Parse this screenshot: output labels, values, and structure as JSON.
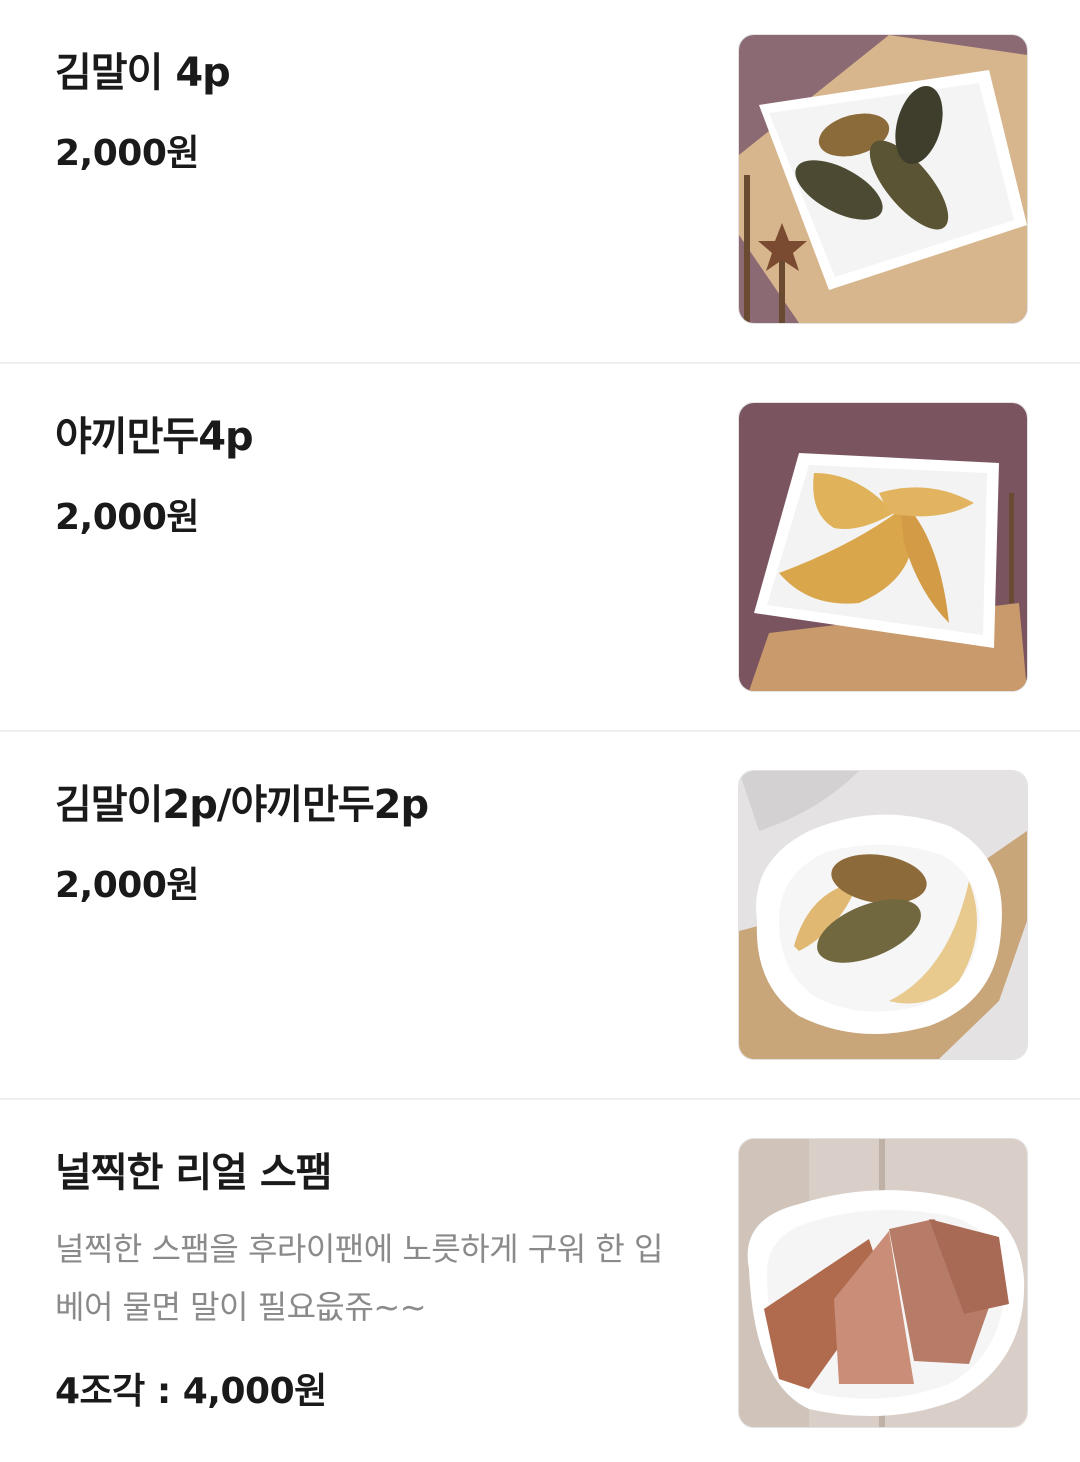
{
  "items": [
    {
      "name": "김말이 4p",
      "price": "2,000원",
      "image": "fried-seaweed-rolls-photo"
    },
    {
      "name": "야끼만두4p",
      "price": "2,000원",
      "image": "fried-dumplings-photo"
    },
    {
      "name": "김말이2p/야끼만두2p",
      "price": "2,000원",
      "image": "mixed-fried-rolls-dumplings-photo"
    },
    {
      "name": "널찍한 리얼 스팸",
      "description": "널찍한 스팸을 후라이팬에 노릇하게 구워 한 입 베어 물면 말이 필요읎쥬~~",
      "price": "4조각 : 4,000원",
      "image": "grilled-spam-slices-photo"
    }
  ],
  "colors": {
    "text": "#1a1a1a",
    "description": "#8a8a8a",
    "divider": "#eeeeee"
  }
}
